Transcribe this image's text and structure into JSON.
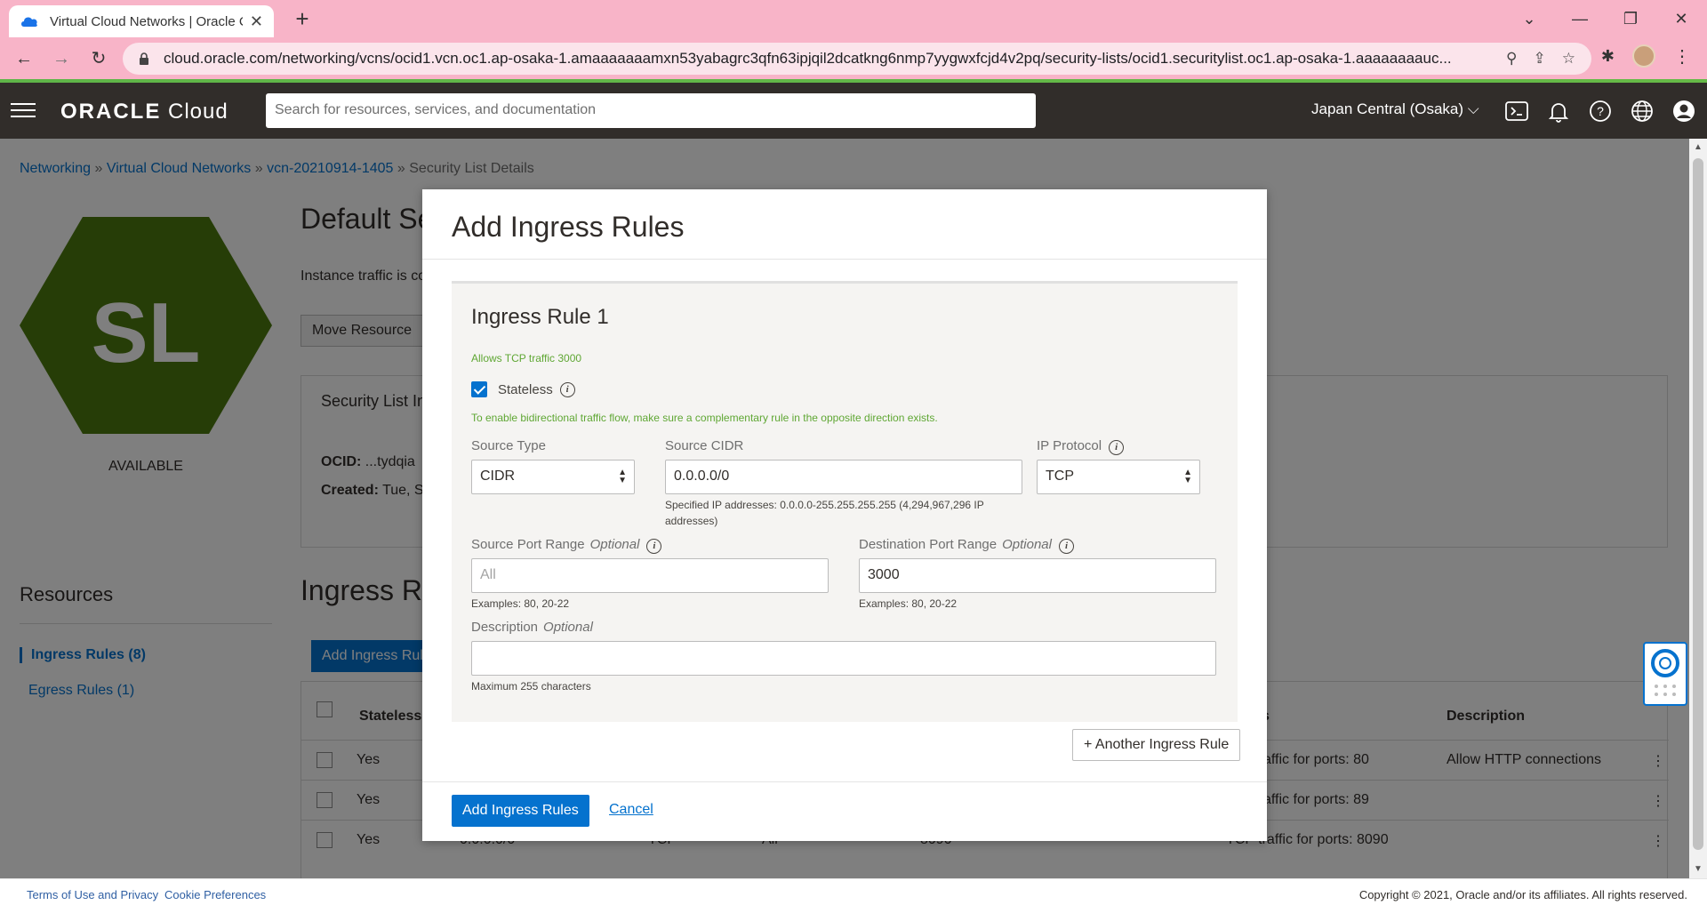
{
  "browser": {
    "tab_title": "Virtual Cloud Networks | Oracle C",
    "tab_close": "✕",
    "new_tab": "+",
    "url": "cloud.oracle.com/networking/vcns/ocid1.vcn.oc1.ap-osaka-1.amaaaaaaamxn53yabagrc3qfn63ipjqil2dcatkng6nmp7yygwxfcjd4v2pq/security-lists/ocid1.securitylist.oc1.ap-osaka-1.aaaaaaaauc...",
    "back": "←",
    "forward": "→",
    "reload": "↻"
  },
  "header": {
    "logo_brand": "ORACLE",
    "logo_product": "Cloud",
    "search_placeholder": "Search for resources, services, and documentation",
    "region": "Japan Central (Osaka)"
  },
  "breadcrumb": {
    "items": [
      "Networking",
      "Virtual Cloud Networks",
      "vcn-20210914-1405"
    ],
    "separator": "»",
    "current": "Security List Details"
  },
  "resource_summary": {
    "initials": "SL",
    "status": "AVAILABLE",
    "title": "Default Se",
    "instance_text": "Instance traffic is co",
    "move_button": "Move Resource",
    "section_header": "Security List In",
    "ocid_label": "OCID:",
    "ocid_value": "...tydqia",
    "created_label": "Created:",
    "created_value": "Tue, S"
  },
  "resources_nav": {
    "title": "Resources",
    "items": [
      {
        "label": "Ingress Rules (8)",
        "active": true
      },
      {
        "label": "Egress Rules (1)",
        "active": false
      }
    ]
  },
  "ingress_table": {
    "heading": "Ingress Ru",
    "add_button": "Add Ingress Rul",
    "headers": [
      "Stateless",
      "s",
      "Description"
    ],
    "rows": [
      {
        "stateless": "Yes",
        "source": "",
        "protocol": "",
        "src_port": "",
        "dst_port": "",
        "type": "affic for ports: 80",
        "description": "Allow HTTP connections"
      },
      {
        "stateless": "Yes",
        "source": "",
        "protocol": "",
        "src_port": "",
        "dst_port": "",
        "type": "affic for ports: 89",
        "description": ""
      },
      {
        "stateless": "Yes",
        "source": "0.0.0.0/0",
        "protocol": "TCP",
        "src_port": "All",
        "dst_port": "8090",
        "type": "TCP traffic for ports: 8090",
        "description": ""
      }
    ]
  },
  "modal": {
    "title": "Add Ingress Rules",
    "rule_title": "Ingress Rule 1",
    "rule_summary": "Allows TCP traffic 3000",
    "stateless_label": "Stateless",
    "stateless_checked": true,
    "stateless_hint": "To enable bidirectional traffic flow, make sure a complementary rule in the opposite direction exists.",
    "source_type_label": "Source Type",
    "source_type_value": "CIDR",
    "source_cidr_label": "Source CIDR",
    "source_cidr_value": "0.0.0.0/0",
    "source_cidr_help": "Specified IP addresses: 0.0.0.0-255.255.255.255 (4,294,967,296 IP addresses)",
    "ip_protocol_label": "IP Protocol",
    "ip_protocol_value": "TCP",
    "source_port_label": "Source Port Range",
    "source_port_optional": "Optional",
    "source_port_placeholder": "All",
    "source_port_help": "Examples: 80, 20-22",
    "dest_port_label": "Destination Port Range",
    "dest_port_optional": "Optional",
    "dest_port_value": "3000",
    "dest_port_help": "Examples: 80, 20-22",
    "description_label": "Description",
    "description_optional": "Optional",
    "description_value": "",
    "description_help": "Maximum 255 characters",
    "another_rule_button": "+ Another Ingress Rule",
    "submit_button": "Add Ingress Rules",
    "cancel_link": "Cancel"
  },
  "footer": {
    "terms": "Terms of Use and Privacy",
    "cookies": "Cookie Preferences",
    "copyright": "Copyright © 2021, Oracle and/or its affiliates. All rights reserved."
  },
  "colors": {
    "accent": "#0572ce",
    "header_bg": "#312d2a",
    "hex_green": "#4d7a0f",
    "hint_green": "#5fa734",
    "tab_pink": "#f8b4c8"
  },
  "icons": [
    "search-icon",
    "share-icon",
    "star-icon",
    "puzzle-icon",
    "cloud-shell-icon",
    "bell-icon",
    "help-icon",
    "globe-icon",
    "user-icon",
    "info-icon",
    "lifebuoy-icon"
  ]
}
